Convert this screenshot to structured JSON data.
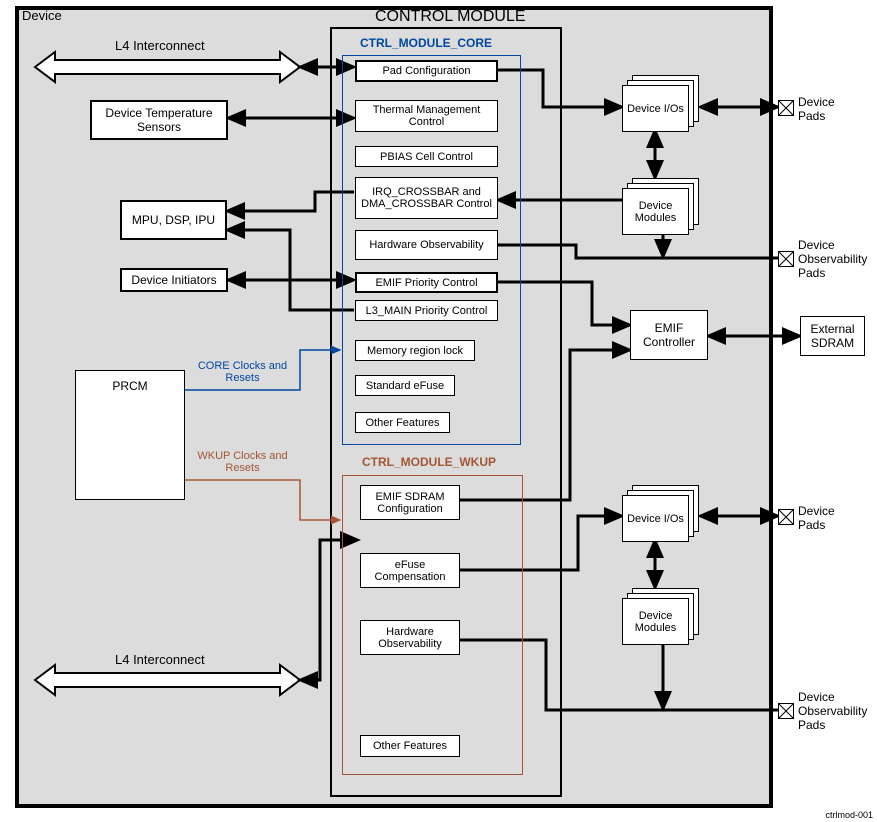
{
  "device": {
    "title": "Device",
    "control_title": "CONTROL MODULE",
    "core_title": "CTRL_MODULE_CORE",
    "wkup_title": "CTRL_MODULE_WKUP"
  },
  "interconnect": {
    "top": "L4 Interconnect",
    "bottom": "L4 Interconnect"
  },
  "left_blocks": {
    "temp_sensors": "Device Temperature Sensors",
    "mpu": "MPU, DSP, IPU",
    "initiators": "Device Initiators",
    "prcm": "PRCM"
  },
  "prcm_labels": {
    "core": "CORE Clocks and Resets",
    "wkup": "WKUP Clocks and Resets"
  },
  "core_items": {
    "pad": "Pad Configuration",
    "thermal": "Thermal Management Control",
    "pbias": "PBIAS Cell Control",
    "crossbar": "IRQ_CROSSBAR and DMA_CROSSBAR Control",
    "hwobs": "Hardware Observability",
    "emif_prio": "EMIF Priority Control",
    "l3_prio": "L3_MAIN Priority Control",
    "memlock": "Memory region lock",
    "efuse": "Standard eFuse",
    "other": "Other Features"
  },
  "wkup_items": {
    "emif_sdram": "EMIF SDRAM Configuration",
    "efuse_comp": "eFuse Compensation",
    "hwobs": "Hardware Observability",
    "other": "Other Features"
  },
  "right_blocks": {
    "device_ios": "Device I/Os",
    "device_modules": "Device Modules",
    "emif_controller": "EMIF Controller"
  },
  "external": {
    "device_pads": "Device Pads",
    "obs_pads": "Device Observability Pads",
    "sdram": "External SDRAM"
  },
  "footer": "ctrlmod-001"
}
